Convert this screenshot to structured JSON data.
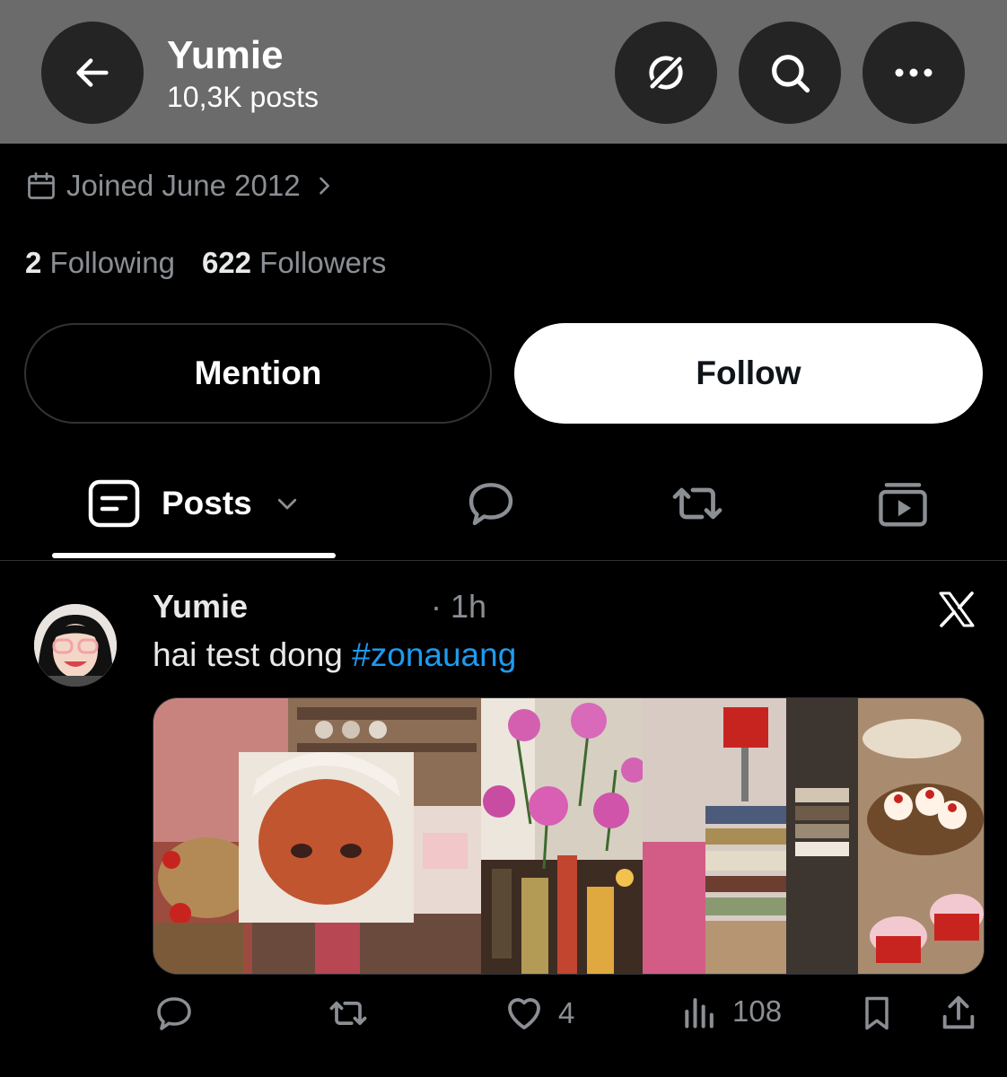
{
  "header": {
    "title": "Yumie",
    "subtitle": "10,3K posts",
    "background": "#6b6b6b",
    "back_icon": "arrow-left-icon",
    "grok_icon": "grok-icon",
    "search_icon": "search-icon",
    "more_icon": "more-icon"
  },
  "profile": {
    "joined": "Joined June 2012",
    "following_count": "2",
    "following_label": "Following",
    "followers_count": "622",
    "followers_label": "Followers"
  },
  "buttons": {
    "mention": "Mention",
    "follow": "Follow"
  },
  "tabs": {
    "posts_label": "Posts",
    "icons": [
      "posts-icon",
      "replies-icon",
      "reposts-icon",
      "media-icon"
    ]
  },
  "post": {
    "author": "Yumie",
    "time": "· 1h",
    "text": "hai test dong ",
    "hashtag": "#zonauang",
    "source_icon": "x-logo-icon",
    "likes": "4",
    "views": "108"
  },
  "colors": {
    "accent": "#1d9bf0",
    "muted": "#8b8f94",
    "background": "#000000"
  }
}
